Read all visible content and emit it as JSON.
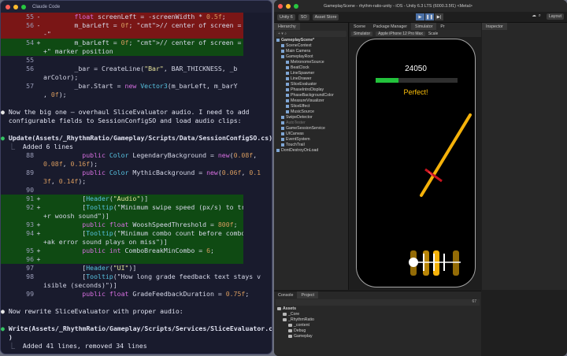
{
  "terminal": {
    "title": "Claude Code",
    "removed_lines": [
      {
        "num": "55",
        "sign": "-",
        "code": "        float screenLeft = -screenWidth * 0.5f;"
      },
      {
        "num": "56",
        "sign": "-",
        "code": "        m_barLeft = 0f; // center of screen = \"now"
      },
      {
        "num": "",
        "sign": "",
        "code": "-\""
      }
    ],
    "added_marker": [
      {
        "num": "54",
        "sign": "+",
        "code": "        m_barLeft = 0f; // center of screen = \"now"
      },
      {
        "num": "",
        "sign": "",
        "code": "+\" marker position"
      }
    ],
    "context_a": [
      {
        "num": "55",
        "code": ""
      },
      {
        "num": "56",
        "code": "        _bar = CreateLine(\"Bar\", BAR_THICKNESS, _b"
      },
      {
        "num": "",
        "code": "arColor);"
      },
      {
        "num": "57",
        "code": "        _bar.Start = new Vector3(m_barLeft, m_barY"
      },
      {
        "num": "",
        "code": ", 0f);"
      }
    ],
    "message1_l1": "Now the big one — overhaul SliceEvaluator audio. I need to add",
    "message1_l2": "configurable fields to SessionConfigSO and load audio clips:",
    "update_call": "Update(Assets/_RhythmRatio/Gameplay/Scripts/Data/SessionConfigSO.cs)",
    "update_summary": "Added 6 lines",
    "context_b": [
      {
        "num": "88",
        "code": "          public Color LegendaryBackground = new(0.08f,"
      },
      {
        "num": "",
        "code": "0.08f, 0.16f);"
      },
      {
        "num": "89",
        "code": "          public Color MythicBackground = new(0.06f, 0.1"
      },
      {
        "num": "",
        "code": "3f, 0.14f);"
      },
      {
        "num": "90",
        "code": ""
      }
    ],
    "added_block": [
      {
        "num": "91",
        "sign": "+",
        "code": "          [Header(\"Audio\")]"
      },
      {
        "num": "92",
        "sign": "+",
        "code": "          [Tooltip(\"Minimum swipe speed (px/s) to trigge"
      },
      {
        "num": "",
        "sign": "",
        "code": "+r woosh sound\")]"
      },
      {
        "num": "93",
        "sign": "+",
        "code": "          public float WooshSpeedThreshold = 800f;"
      },
      {
        "num": "94",
        "sign": "+",
        "code": "          [Tooltip(\"Minimum combo count before combo-bre"
      },
      {
        "num": "",
        "sign": "",
        "code": "+ak error sound plays on miss\")]"
      },
      {
        "num": "95",
        "sign": "+",
        "code": "          public int ComboBreakMinCombo = 6;"
      },
      {
        "num": "96",
        "sign": "+",
        "code": ""
      }
    ],
    "context_c": [
      {
        "num": "97",
        "code": "          [Header(\"UI\")]"
      },
      {
        "num": "98",
        "code": "          [Tooltip(\"How long grade feedback text stays v"
      },
      {
        "num": "",
        "code": "isible (seconds)\")]"
      },
      {
        "num": "99",
        "code": "          public float GradeFeedbackDuration = 0.75f;"
      }
    ],
    "message2": "Now rewrite SliceEvaluator with proper audio:",
    "write_call_l1": "Write(Assets/_RhythmRatio/Gameplay/Scripts/Services/SliceEvaluator.cs",
    "write_call_l2": ")",
    "write_summary": "Added 41 lines, removed 34 lines"
  },
  "unity": {
    "window_title": "GameplayScene - rhythm-ratio-unity - iOS - Unity 6.3 LTS (6000.3.5f1) <Metal>",
    "toolbar": {
      "account": "Unity 6",
      "so": "SO",
      "store": "Asset Store",
      "layout": "Layout"
    },
    "left_tabs": [
      "Hierarchy"
    ],
    "center_tabs": [
      "Scene",
      "Package Manager",
      "Simulator",
      "Pr"
    ],
    "right_tabs": [
      "Inspector"
    ],
    "game_bar": {
      "mode": "Simulator",
      "device": "Apple iPhone 12 Pro Max",
      "scale_label": "Scale"
    },
    "hierarchy": [
      {
        "label": "GameplayScene*",
        "depth": 0,
        "bold": true
      },
      {
        "label": "SceneContext",
        "depth": 1
      },
      {
        "label": "Main Camera",
        "depth": 1
      },
      {
        "label": "GameplayRoot",
        "depth": 1
      },
      {
        "label": "MetronomeSource",
        "depth": 2
      },
      {
        "label": "BeatClock",
        "depth": 2
      },
      {
        "label": "LineSpawner",
        "depth": 2
      },
      {
        "label": "LineDrawer",
        "depth": 2
      },
      {
        "label": "SliceEvaluator",
        "depth": 2
      },
      {
        "label": "PhaseIntroDisplay",
        "depth": 2
      },
      {
        "label": "PhaseBackgroundColor",
        "depth": 2
      },
      {
        "label": "MeasureVisualizer",
        "depth": 2
      },
      {
        "label": "SliceEffect",
        "depth": 2
      },
      {
        "label": "MusicSource",
        "depth": 2
      },
      {
        "label": "SwipeDetector",
        "depth": 1
      },
      {
        "label": "AutoTester",
        "depth": 1,
        "dim": true
      },
      {
        "label": "GameSessionService",
        "depth": 1
      },
      {
        "label": "UICanvas",
        "depth": 1
      },
      {
        "label": "EventSystem",
        "depth": 1
      },
      {
        "label": "TouchTrail",
        "depth": 1
      },
      {
        "label": "DontDestroyOnLoad",
        "depth": 0
      }
    ],
    "game": {
      "score": "24050",
      "health": 0.28,
      "grade": "Perfect!"
    },
    "bottom_tabs": [
      "Console",
      "Project"
    ],
    "project": [
      {
        "label": "Assets",
        "depth": 0,
        "bold": true
      },
      {
        "label": "_Core",
        "depth": 1
      },
      {
        "label": "_RhythmRatio",
        "depth": 1
      },
      {
        "label": "_content",
        "depth": 2
      },
      {
        "label": "Debug",
        "depth": 2
      },
      {
        "label": "Gameplay",
        "depth": 2
      }
    ],
    "project_count": "67"
  }
}
